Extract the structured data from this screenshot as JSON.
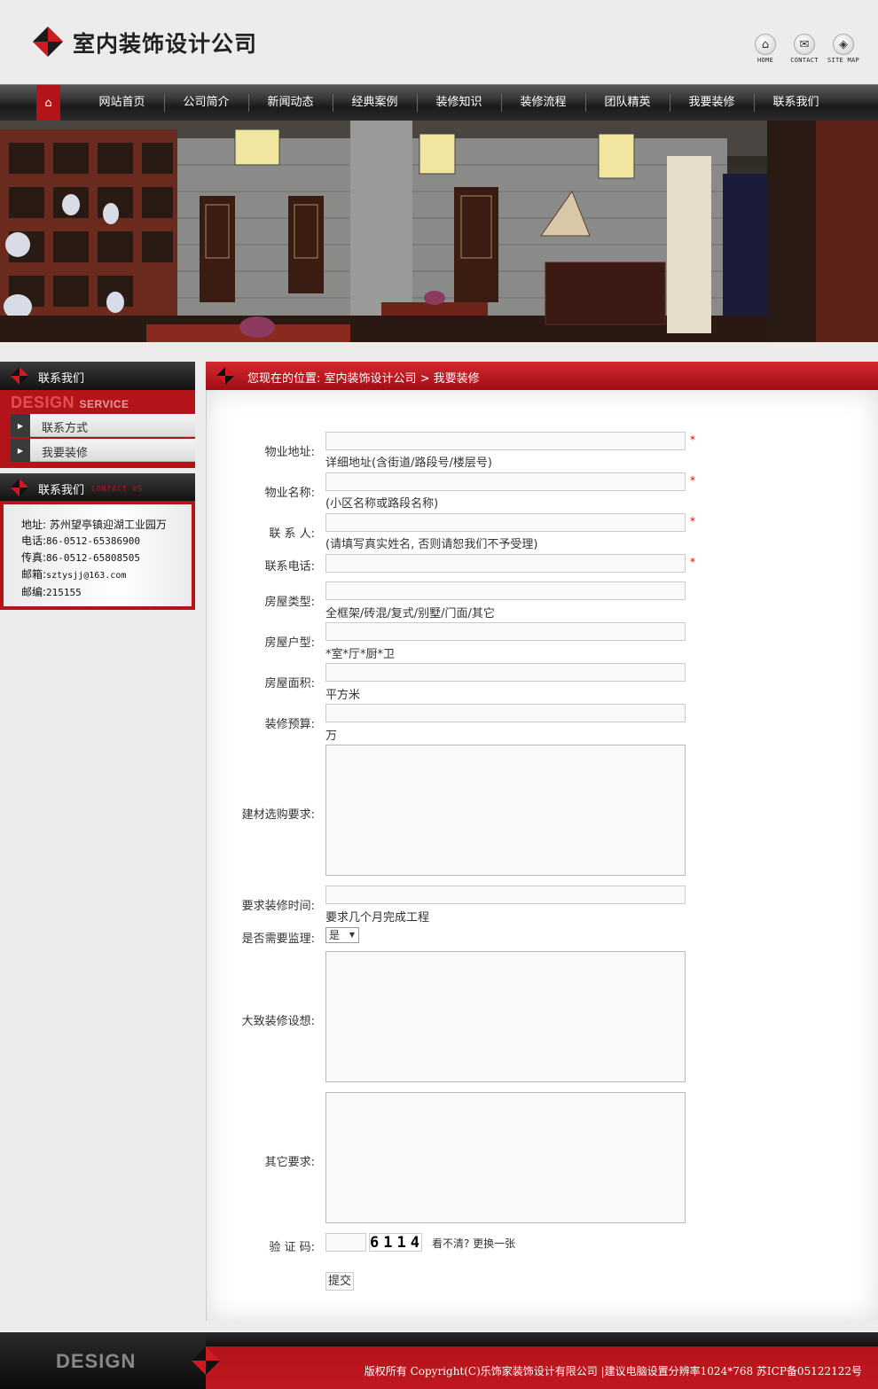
{
  "header": {
    "title": "室内装饰设计公司",
    "quick_links": [
      {
        "label": "HOME",
        "icon": "home-icon"
      },
      {
        "label": "CONTACT",
        "icon": "mail-icon"
      },
      {
        "label": "SITE MAP",
        "icon": "sitemap-icon"
      }
    ]
  },
  "nav": {
    "home_icon": "home-icon",
    "items": [
      "网站首页",
      "公司简介",
      "新闻动态",
      "经典案例",
      "装修知识",
      "装修流程",
      "团队精英",
      "我要装修",
      "联系我们"
    ]
  },
  "sidebar": {
    "section1_title": "联系我们",
    "design_service_main": "DESIGN",
    "design_service_sub": "SERVICE",
    "links": [
      "联系方式",
      "我要装修"
    ],
    "section2_title": "联系我们",
    "section2_sub": "CONTACT US",
    "contact": {
      "address": "地址: 苏州望亭镇迎湖工业园万",
      "phone_label": "电话:",
      "phone": "86-0512-65386900",
      "fax_label": "传真:",
      "fax": "86-0512-65808505",
      "email_label": "邮箱:",
      "email": "sztysjj@163.com",
      "zip_label": "邮编:",
      "zip": "215155"
    }
  },
  "main": {
    "breadcrumb": "您现在的位置: 室内装饰设计公司 > 我要装修",
    "form": {
      "fields": [
        {
          "label": "物业地址:",
          "hint": "详细地址(含街道/路段号/楼层号)",
          "required": "*"
        },
        {
          "label": "物业名称:",
          "hint": "(小区名称或路段名称)",
          "required": "*"
        },
        {
          "label": "联 系 人:",
          "hint": "(请填写真实姓名, 否则请恕我们不予受理)",
          "required": "*"
        },
        {
          "label": "联系电话:",
          "hint": "",
          "required": "*"
        },
        {
          "label": "房屋类型:",
          "hint": "全框架/砖混/复式/别墅/门面/其它"
        },
        {
          "label": "房屋户型:",
          "hint": "*室*厅*厨*卫"
        },
        {
          "label": "房屋面积:",
          "hint": "平方米"
        },
        {
          "label": "装修预算:",
          "hint": "万"
        }
      ],
      "materials_label": "建材选购要求:",
      "time_label": "要求装修时间:",
      "time_hint": "要求几个月完成工程",
      "supervision_label": "是否需要监理:",
      "supervision_value": "是",
      "idea_label": "大致装修设想:",
      "other_label": "其它要求:",
      "captcha_label": "验 证 码:",
      "captcha_code": "6114",
      "captcha_refresh": "看不清? 更换一张",
      "submit_label": "提交"
    }
  },
  "footer": {
    "brand": "DESIGN",
    "copyright": "版权所有 Copyright(C)乐饰家装饰设计有限公司 |建议电脑设置分辨率1024*768 苏ICP备05122122号"
  },
  "colors": {
    "accent": "#b3141a",
    "dark": "#1a1a1a",
    "background": "#ececec"
  }
}
